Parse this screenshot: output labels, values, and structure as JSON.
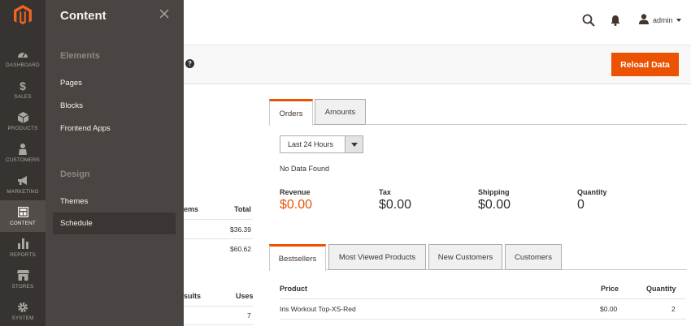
{
  "nav": {
    "items": [
      {
        "label": "DASHBOARD",
        "icon": "speedometer-icon"
      },
      {
        "label": "SALES",
        "icon": "dollar-icon"
      },
      {
        "label": "PRODUCTS",
        "icon": "box-icon"
      },
      {
        "label": "CUSTOMERS",
        "icon": "person-icon"
      },
      {
        "label": "MARKETING",
        "icon": "megaphone-icon"
      },
      {
        "label": "CONTENT",
        "icon": "layout-icon"
      },
      {
        "label": "REPORTS",
        "icon": "bar-chart-icon"
      },
      {
        "label": "STORES",
        "icon": "storefront-icon"
      },
      {
        "label": "SYSTEM",
        "icon": "gear-icon"
      }
    ],
    "active": "CONTENT"
  },
  "flyout": {
    "title": "Content",
    "sections": [
      {
        "title": "Elements",
        "links": [
          "Pages",
          "Blocks",
          "Frontend Apps"
        ]
      },
      {
        "title": "Design",
        "links": [
          "Themes",
          "Schedule"
        ]
      }
    ],
    "active_link": "Schedule"
  },
  "header": {
    "user": "admin"
  },
  "pagebar": {
    "help": "?",
    "reload_label": "Reload Data"
  },
  "left_grid_1": {
    "headers": [
      "ems",
      "Total"
    ],
    "rows": [
      "$36.39",
      "$60.62"
    ]
  },
  "left_grid_2": {
    "headers": [
      "sults",
      "Uses"
    ],
    "rows": [
      "7"
    ]
  },
  "chart_tabs": {
    "tabs": [
      "Orders",
      "Amounts"
    ],
    "active": "Orders",
    "period": "Last 24 Hours",
    "message": "No Data Found"
  },
  "totals": [
    {
      "label": "Revenue",
      "value": "$0.00"
    },
    {
      "label": "Tax",
      "value": "$0.00"
    },
    {
      "label": "Shipping",
      "value": "$0.00"
    },
    {
      "label": "Quantity",
      "value": "0"
    }
  ],
  "grid_tabs": {
    "tabs": [
      "Bestsellers",
      "Most Viewed Products",
      "New Customers",
      "Customers"
    ],
    "active": "Bestsellers",
    "columns": [
      "Product",
      "Price",
      "Quantity"
    ],
    "rows": [
      {
        "product": "Iris Workout Top-XS-Red",
        "price": "$0.00",
        "quantity": "2"
      }
    ]
  },
  "colors": {
    "accent": "#eb5202",
    "nav_bg": "#373330",
    "flyout_bg": "#4a4542"
  }
}
